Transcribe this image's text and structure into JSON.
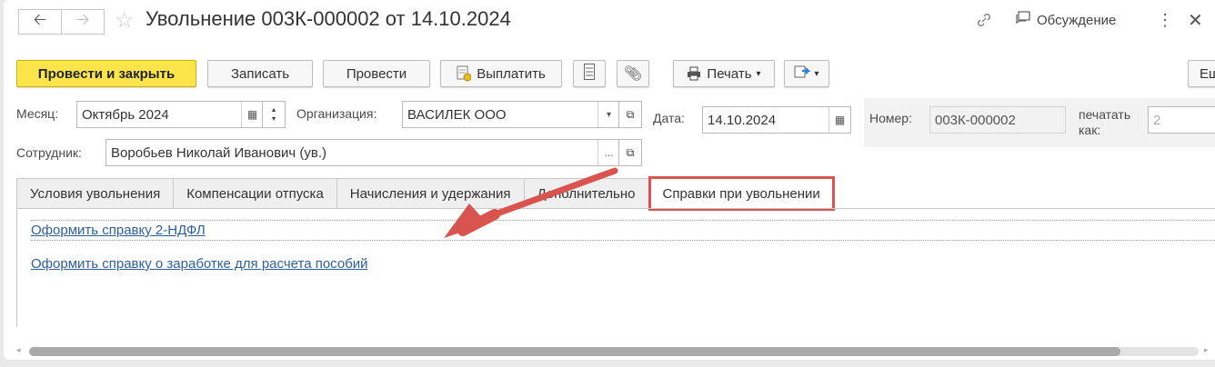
{
  "window": {
    "title": "Увольнение 003К-000002 от 14.10.2024",
    "discussion_label": "Обсуждение"
  },
  "toolbar": {
    "post_and_close": "Провести и закрыть",
    "save": "Записать",
    "post": "Провести",
    "pay": "Выплатить",
    "print": "Печать",
    "more_cut": "Еш"
  },
  "form": {
    "month_label": "Месяц:",
    "month_value": "Октябрь 2024",
    "org_label": "Организация:",
    "org_value": "ВАСИЛЕК ООО",
    "date_label": "Дата:",
    "date_value": "14.10.2024",
    "number_label": "Номер:",
    "number_value": "003К-000002",
    "print_as_label_1": "печатать",
    "print_as_label_2": "как:",
    "print_as_value": "2",
    "employee_label": "Сотрудник:",
    "employee_value": "Воробьев Николай Иванович (ув.)"
  },
  "tabs": [
    {
      "label": "Условия увольнения"
    },
    {
      "label": "Компенсации отпуска"
    },
    {
      "label": "Начисления и удержания"
    },
    {
      "label": "Дополнительно"
    },
    {
      "label": "Справки при увольнении"
    }
  ],
  "links": {
    "ndfl": "Оформить справку 2-НДФЛ",
    "earnings": "Оформить справку о заработке для расчета пособий"
  },
  "colors": {
    "primary_button": "#fbe54a",
    "highlight": "#d9534f",
    "link": "#2d5f9e"
  }
}
